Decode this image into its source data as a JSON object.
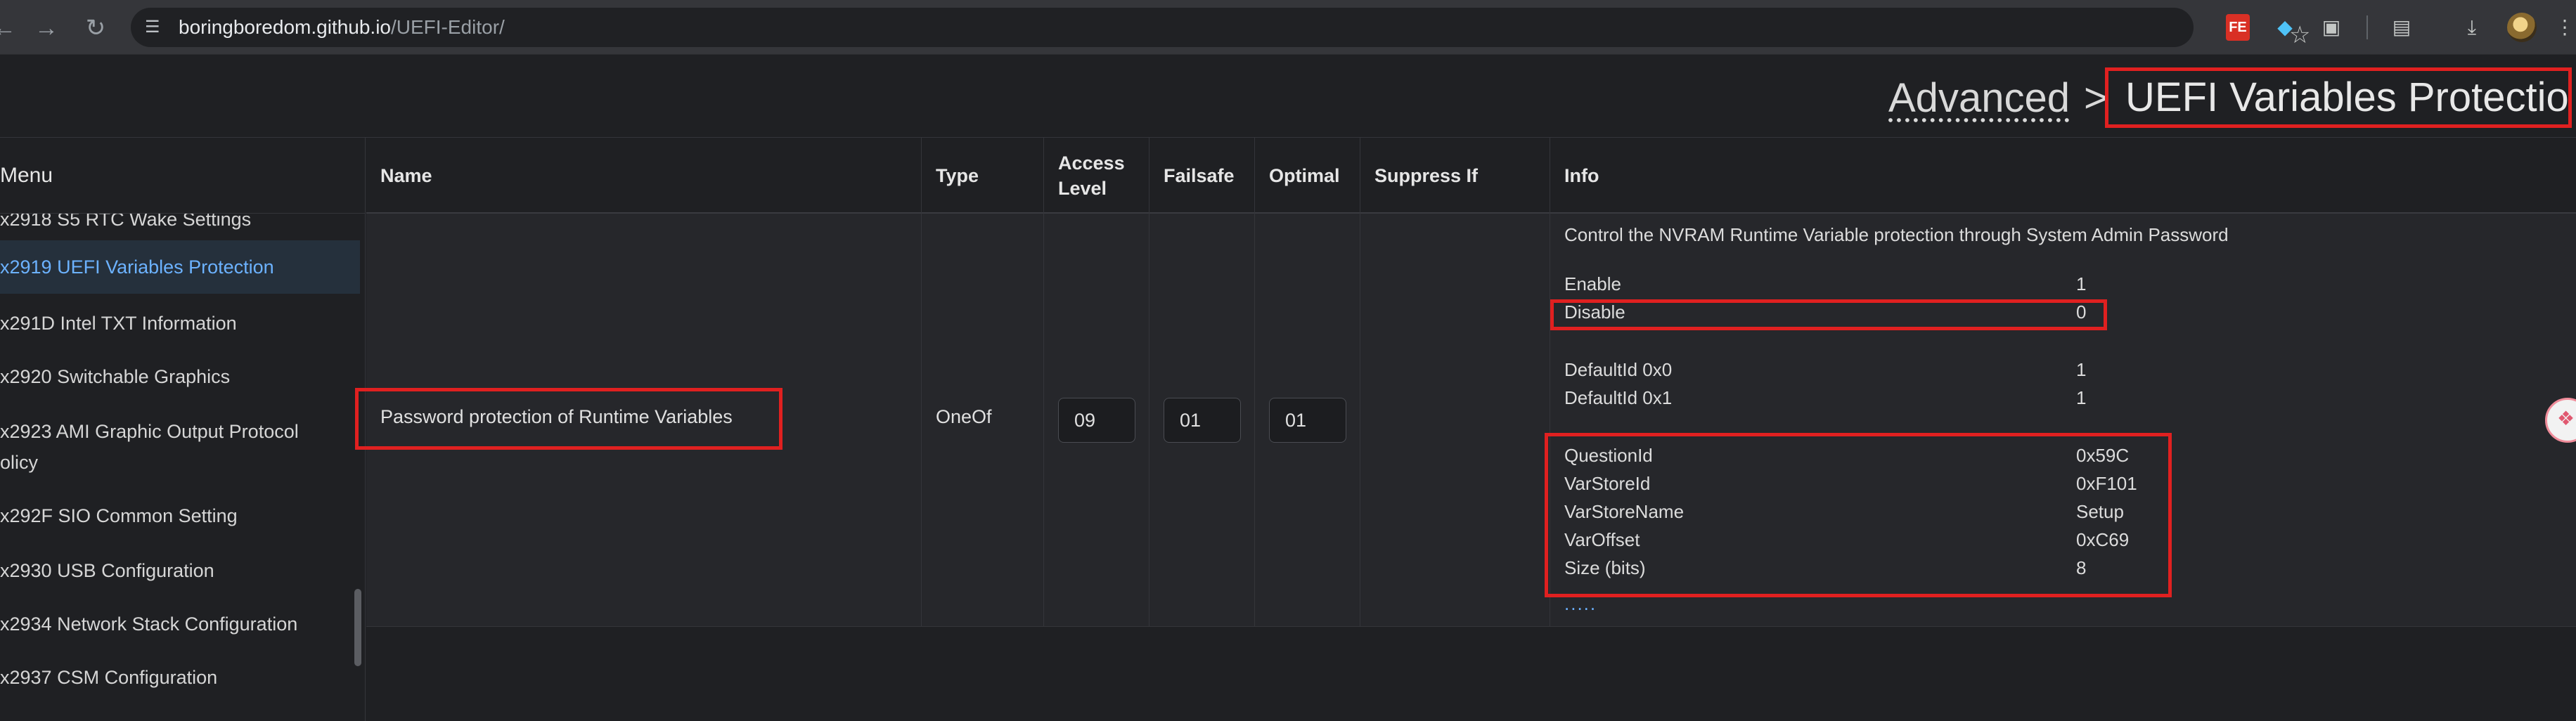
{
  "browser": {
    "url_domain": "boringboredom.github.io",
    "url_path": "/UEFI-Editor/",
    "ext_fe_label": "FE"
  },
  "header": {
    "crumb_parent": "Advanced",
    "separator": ">",
    "crumb_current": "UEFI Variables Protection"
  },
  "sidebar": {
    "title": "Menu",
    "items": [
      {
        "label": "x2918 S5 RTC Wake Settings"
      },
      {
        "label": "x2919 UEFI Variables Protection"
      },
      {
        "label": "x291D Intel TXT Information"
      },
      {
        "label": "x2920 Switchable Graphics"
      },
      {
        "label": "x2923 AMI Graphic Output Protocol"
      },
      {
        "label": "olicy"
      },
      {
        "label": "x292F SIO Common Setting"
      },
      {
        "label": "x2930 USB Configuration"
      },
      {
        "label": "x2934 Network Stack Configuration"
      },
      {
        "label": "x2937 CSM Configuration"
      }
    ]
  },
  "table": {
    "headers": {
      "name": "Name",
      "type": "Type",
      "access_level": "Access Level",
      "failsafe": "Failsafe",
      "optimal": "Optimal",
      "suppress_if": "Suppress If",
      "info": "Info"
    },
    "row": {
      "name": "Password protection of Runtime Variables",
      "type": "OneOf",
      "access_level": "09",
      "failsafe": "01",
      "optimal": "01",
      "suppress_if": "",
      "info": {
        "description": "Control the NVRAM Runtime Variable protection through System Admin Password",
        "options": [
          {
            "label": "Enable",
            "value": "1"
          },
          {
            "label": "Disable",
            "value": "0"
          }
        ],
        "defaults": [
          {
            "label": "DefaultId 0x0",
            "value": "1"
          },
          {
            "label": "DefaultId 0x1",
            "value": "1"
          }
        ],
        "meta": [
          {
            "label": "QuestionId",
            "value": "0x59C"
          },
          {
            "label": "VarStoreId",
            "value": "0xF101"
          },
          {
            "label": "VarStoreName",
            "value": "Setup"
          },
          {
            "label": "VarOffset",
            "value": "0xC69"
          },
          {
            "label": "Size (bits)",
            "value": "8"
          }
        ],
        "more": "....."
      }
    }
  },
  "colors": {
    "highlight": "#e02020",
    "accent": "#6cb2ff",
    "background": "#1f2023"
  }
}
